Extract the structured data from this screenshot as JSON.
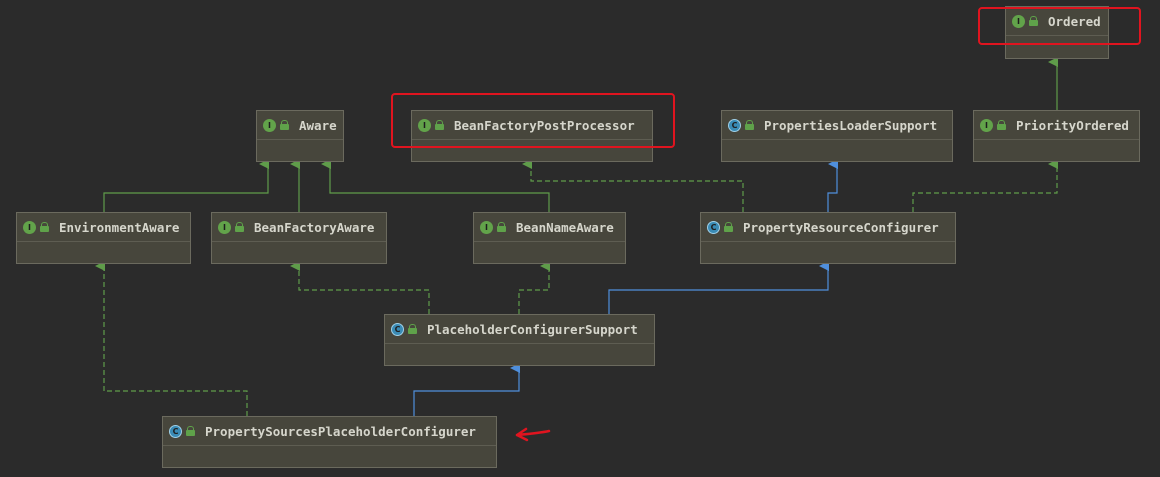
{
  "diagram": {
    "nodes": [
      {
        "id": "ordered",
        "label": "Ordered",
        "kind": "I",
        "highlighted": true
      },
      {
        "id": "aware",
        "label": "Aware",
        "kind": "I"
      },
      {
        "id": "bfpp",
        "label": "BeanFactoryPostProcessor",
        "kind": "I",
        "highlighted": true
      },
      {
        "id": "pls",
        "label": "PropertiesLoaderSupport",
        "kind": "C"
      },
      {
        "id": "priority",
        "label": "PriorityOrdered",
        "kind": "I"
      },
      {
        "id": "envaware",
        "label": "EnvironmentAware",
        "kind": "I"
      },
      {
        "id": "bfaware",
        "label": "BeanFactoryAware",
        "kind": "I"
      },
      {
        "id": "bnaware",
        "label": "BeanNameAware",
        "kind": "I"
      },
      {
        "id": "prc",
        "label": "PropertyResourceConfigurer",
        "kind": "C"
      },
      {
        "id": "pcs",
        "label": "PlaceholderConfigurerSupport",
        "kind": "C"
      },
      {
        "id": "psp",
        "label": "PropertySourcesPlaceholderConfigurer",
        "kind": "C",
        "pointed_by_arrow": true
      }
    ],
    "edges": [
      {
        "from": "priority",
        "to": "ordered",
        "type": "extends"
      },
      {
        "from": "envaware",
        "to": "aware",
        "type": "extends"
      },
      {
        "from": "bfaware",
        "to": "aware",
        "type": "extends"
      },
      {
        "from": "bnaware",
        "to": "aware",
        "type": "extends"
      },
      {
        "from": "prc",
        "to": "bfpp",
        "type": "implements"
      },
      {
        "from": "prc",
        "to": "pls",
        "type": "class-extends"
      },
      {
        "from": "prc",
        "to": "priority",
        "type": "implements"
      },
      {
        "from": "pcs",
        "to": "bfaware",
        "type": "implements"
      },
      {
        "from": "pcs",
        "to": "bnaware",
        "type": "implements"
      },
      {
        "from": "pcs",
        "to": "prc",
        "type": "class-extends"
      },
      {
        "from": "psp",
        "to": "envaware",
        "type": "implements"
      },
      {
        "from": "psp",
        "to": "pcs",
        "type": "class-extends"
      }
    ],
    "colors": {
      "background": "#2b2b2b",
      "node_fill": "#47463c",
      "interface_edge": "#5f9c4a",
      "class_edge": "#4f8fdc",
      "highlight": "#e0141f",
      "badge_interface": "#62a34a",
      "badge_class": "#3a8bb5"
    },
    "icons": {
      "interface": "interface-badge-icon",
      "class": "class-badge-icon",
      "visibility": "public-lock-icon"
    }
  }
}
